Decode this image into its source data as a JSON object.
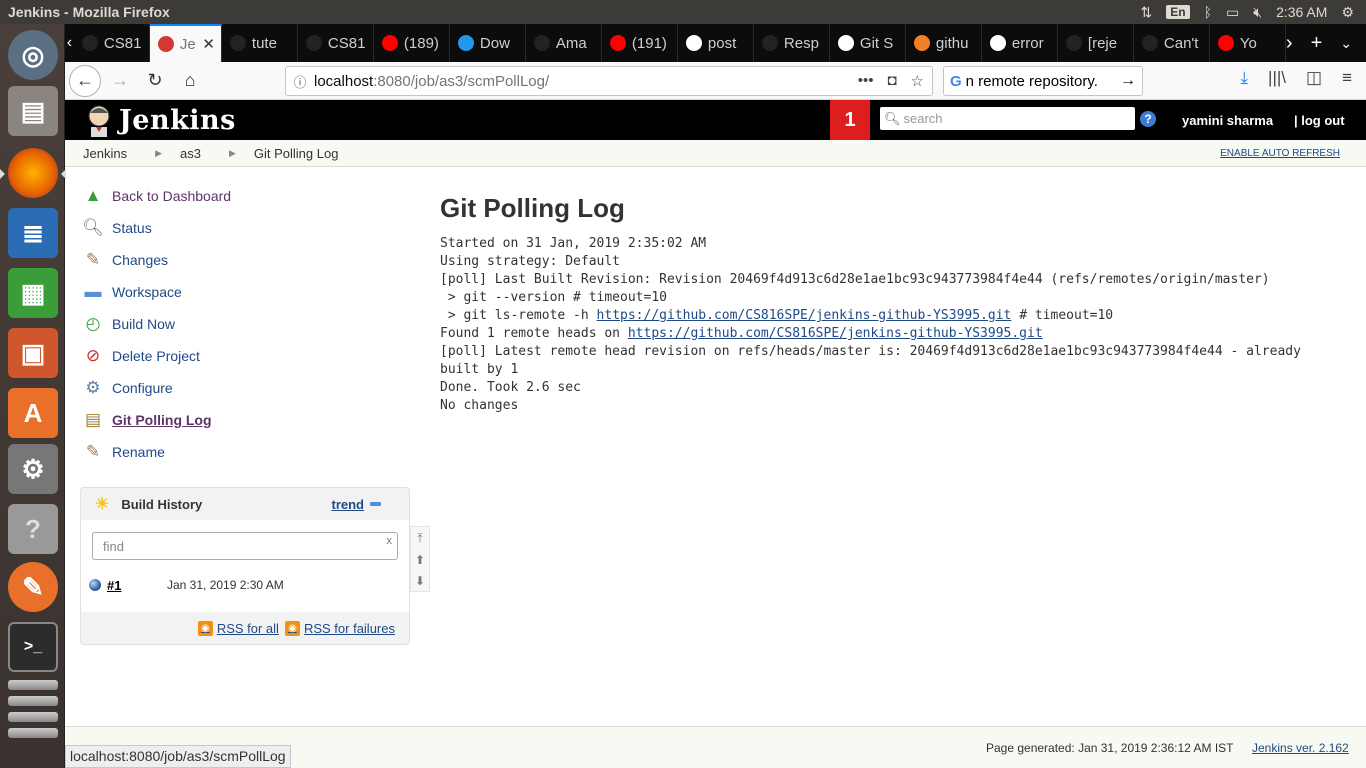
{
  "os": {
    "window_title": "Jenkins - Mozilla Firefox",
    "lang": "En",
    "clock": "2:36 AM"
  },
  "tabs": [
    {
      "label": "CS81",
      "icon": "github-icon",
      "fav_color": "#222"
    },
    {
      "label": "Je",
      "icon": "jenkins-icon",
      "fav_color": "#d33833",
      "selected": true
    },
    {
      "label": "tute",
      "icon": "github-icon",
      "fav_color": "#222"
    },
    {
      "label": "CS81",
      "icon": "github-icon",
      "fav_color": "#222"
    },
    {
      "label": "(189)",
      "icon": "youtube-icon",
      "fav_color": "#ff0000"
    },
    {
      "label": "Dow",
      "icon": "docker-icon",
      "fav_color": "#2496ed"
    },
    {
      "label": "Ama",
      "icon": "amazon-icon",
      "fav_color": "#222"
    },
    {
      "label": "(191)",
      "icon": "youtube-icon",
      "fav_color": "#ff0000"
    },
    {
      "label": "post",
      "icon": "google-icon",
      "fav_color": "#fff"
    },
    {
      "label": "Resp",
      "icon": "github-icon",
      "fav_color": "#222"
    },
    {
      "label": "Git S",
      "icon": "google-icon",
      "fav_color": "#fff"
    },
    {
      "label": "githu",
      "icon": "stackoverflow-icon",
      "fav_color": "#f48024"
    },
    {
      "label": "error",
      "icon": "google-icon",
      "fav_color": "#fff"
    },
    {
      "label": "[reje",
      "icon": "github-icon",
      "fav_color": "#222"
    },
    {
      "label": "Can't",
      "icon": "github-icon",
      "fav_color": "#222"
    },
    {
      "label": "Yo",
      "icon": "youtube-icon",
      "fav_color": "#ff0000"
    }
  ],
  "urlbar": {
    "host": "localhost",
    "path": ":8080/job/as3/scmPollLog/"
  },
  "searchbar": {
    "value": "n remote repository."
  },
  "jenkins": {
    "logo_text": "Jenkins",
    "notification_count": "1",
    "search_placeholder": "search",
    "help": "?",
    "user": "yamini sharma",
    "logout": "| log out"
  },
  "breadcrumb": {
    "items": [
      "Jenkins",
      "as3",
      "Git Polling Log"
    ],
    "auto_refresh": "ENABLE AUTO REFRESH"
  },
  "tasks": [
    {
      "label": "Back to Dashboard",
      "icon": "up-arrow-icon"
    },
    {
      "label": "Status",
      "icon": "magnifier-icon"
    },
    {
      "label": "Changes",
      "icon": "notepad-icon"
    },
    {
      "label": "Workspace",
      "icon": "folder-icon"
    },
    {
      "label": "Build Now",
      "icon": "clock-icon"
    },
    {
      "label": "Delete Project",
      "icon": "no-entry-icon"
    },
    {
      "label": "Configure",
      "icon": "gear-icon"
    },
    {
      "label": "Git Polling Log",
      "icon": "clipboard-icon",
      "current": true
    },
    {
      "label": "Rename",
      "icon": "notepad-icon"
    }
  ],
  "build_history": {
    "title": "Build History",
    "trend": "trend",
    "find_placeholder": "find",
    "clear": "x",
    "builds": [
      {
        "number": "#1",
        "date": "Jan 31, 2019 2:30 AM"
      }
    ],
    "rss_all": "RSS for all",
    "rss_failures": "RSS for failures"
  },
  "main": {
    "title": "Git Polling Log",
    "log_lines": [
      {
        "text": "Started on 31 Jan, 2019 2:35:02 AM"
      },
      {
        "text": "Using strategy: Default"
      },
      {
        "text": "[poll] Last Built Revision: Revision 20469f4d913c6d28e1ae1bc93c943773984f4e44 (refs/remotes/origin/master)"
      },
      {
        "text": " > git --version # timeout=10"
      },
      {
        "pre": " > git ls-remote -h ",
        "link": "https://github.com/CS816SPE/jenkins-github-YS3995.git",
        "post": " # timeout=10"
      },
      {
        "pre": "Found 1 remote heads on ",
        "link": "https://github.com/CS816SPE/jenkins-github-YS3995.git",
        "post": ""
      },
      {
        "text": "[poll] Latest remote head revision on refs/heads/master is: 20469f4d913c6d28e1ae1bc93c943773984f4e44 - already"
      },
      {
        "text": "built by 1"
      },
      {
        "text": "Done. Took 2.6 sec"
      },
      {
        "text": "No changes"
      }
    ]
  },
  "footer": {
    "generated": "Page generated: Jan 31, 2019 2:36:12 AM IST",
    "version": "Jenkins ver. 2.162"
  },
  "statusbar": {
    "text": "localhost:8080/job/as3/scmPollLog"
  }
}
